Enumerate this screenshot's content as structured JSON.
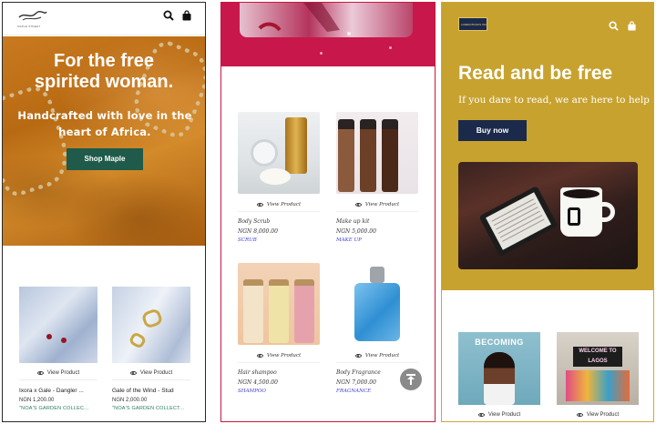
{
  "phone1": {
    "logo_text": "MAPLE STREET",
    "hero": {
      "title_line1": "For the free",
      "title_line2": "spirited woman.",
      "subtitle": "Handcrafted with love in the heart of Africa.",
      "button": "Shop Maple"
    },
    "products": [
      {
        "name": "Ixora x Gale - Dangler ...",
        "price": "NGN 1,200.00",
        "category": "\"NOA'S GARDEN COLLEC...",
        "view_label": "View Product"
      },
      {
        "name": "Gale of the Wind - Stud",
        "price": "NGN 2,000.00",
        "category": "\"NOA'S GARDEN COLLECT...",
        "view_label": "View Product"
      }
    ],
    "colors": {
      "hero_bg": "#c27719",
      "button_bg": "#1f5a4a",
      "category_text": "#2a7a5a"
    }
  },
  "phone2": {
    "products": [
      {
        "name": "Body Scrub",
        "price": "NGN 8,000.00",
        "category": "SCRUB",
        "view_label": "View Product"
      },
      {
        "name": "Make up kit",
        "price": "NGN 5,000.00",
        "category": "MAKE UP",
        "view_label": "View Product"
      },
      {
        "name": "Hair shampoo",
        "price": "NGN 4,500.00",
        "category": "SHAMPOO",
        "view_label": "View Product"
      },
      {
        "name": "Body Fragrance",
        "price": "NGN 7,000.00",
        "category": "FRAGNANCE",
        "view_label": "View Product"
      }
    ],
    "colors": {
      "accent": "#c8174a",
      "category_text": "#3b3bd0"
    },
    "icons": {
      "scroll_top": "arrow-up-to-line-icon"
    }
  },
  "phone3": {
    "logo_text": "LOREM BOOKS INC",
    "hero": {
      "title": "Read and be free",
      "subtitle": "If you dare to read, we are here to help",
      "button": "Buy now"
    },
    "products": [
      {
        "cover_text": "BECOMING",
        "view_label": "View Product"
      },
      {
        "cover_text": "WELCOME TO LAGOS",
        "view_label": "View Product"
      }
    ],
    "colors": {
      "hero_bg": "#c7a22f",
      "button_bg": "#1b2a4a"
    }
  }
}
